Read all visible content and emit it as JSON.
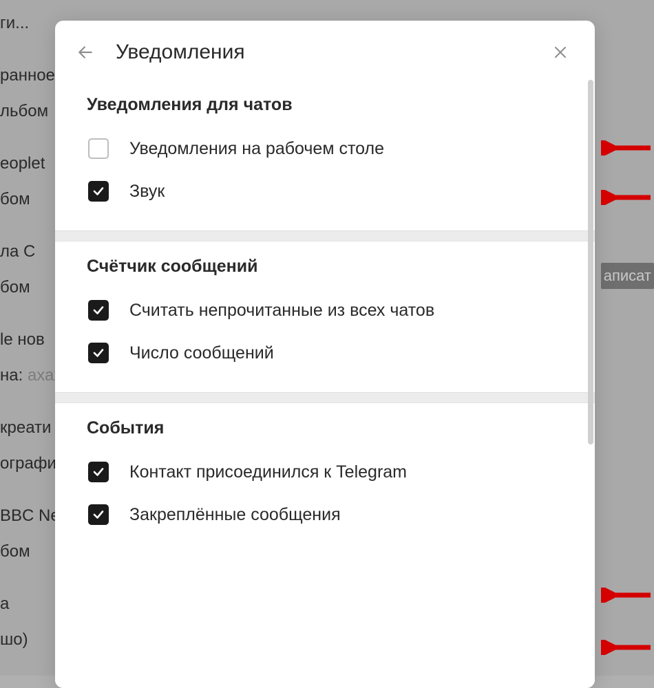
{
  "background": {
    "items": [
      "ги...",
      "",
      "ранное",
      "льбом",
      "",
      "eoplet",
      "бом",
      "",
      "ла С",
      "бом",
      "",
      "le нов",
      "на:",
      "",
      "креати",
      "ографи",
      "",
      "BBC Ne",
      "бом",
      "",
      "а",
      "шо)"
    ],
    "faded_word": "ахах",
    "right_label": "аписат"
  },
  "modal": {
    "title": "Уведомления",
    "sections": [
      {
        "title": "Уведомления для чатов",
        "options": [
          {
            "label": "Уведомления на рабочем столе",
            "checked": false
          },
          {
            "label": "Звук",
            "checked": true
          }
        ]
      },
      {
        "title": "Счётчик сообщений",
        "options": [
          {
            "label": "Считать непрочитанные из всех чатов",
            "checked": true
          },
          {
            "label": "Число сообщений",
            "checked": true
          }
        ]
      },
      {
        "title": "События",
        "options": [
          {
            "label": "Контакт присоединился к Telegram",
            "checked": true
          },
          {
            "label": "Закреплённые сообщения",
            "checked": true
          }
        ]
      }
    ]
  },
  "arrows": {
    "color": "#d40000"
  }
}
